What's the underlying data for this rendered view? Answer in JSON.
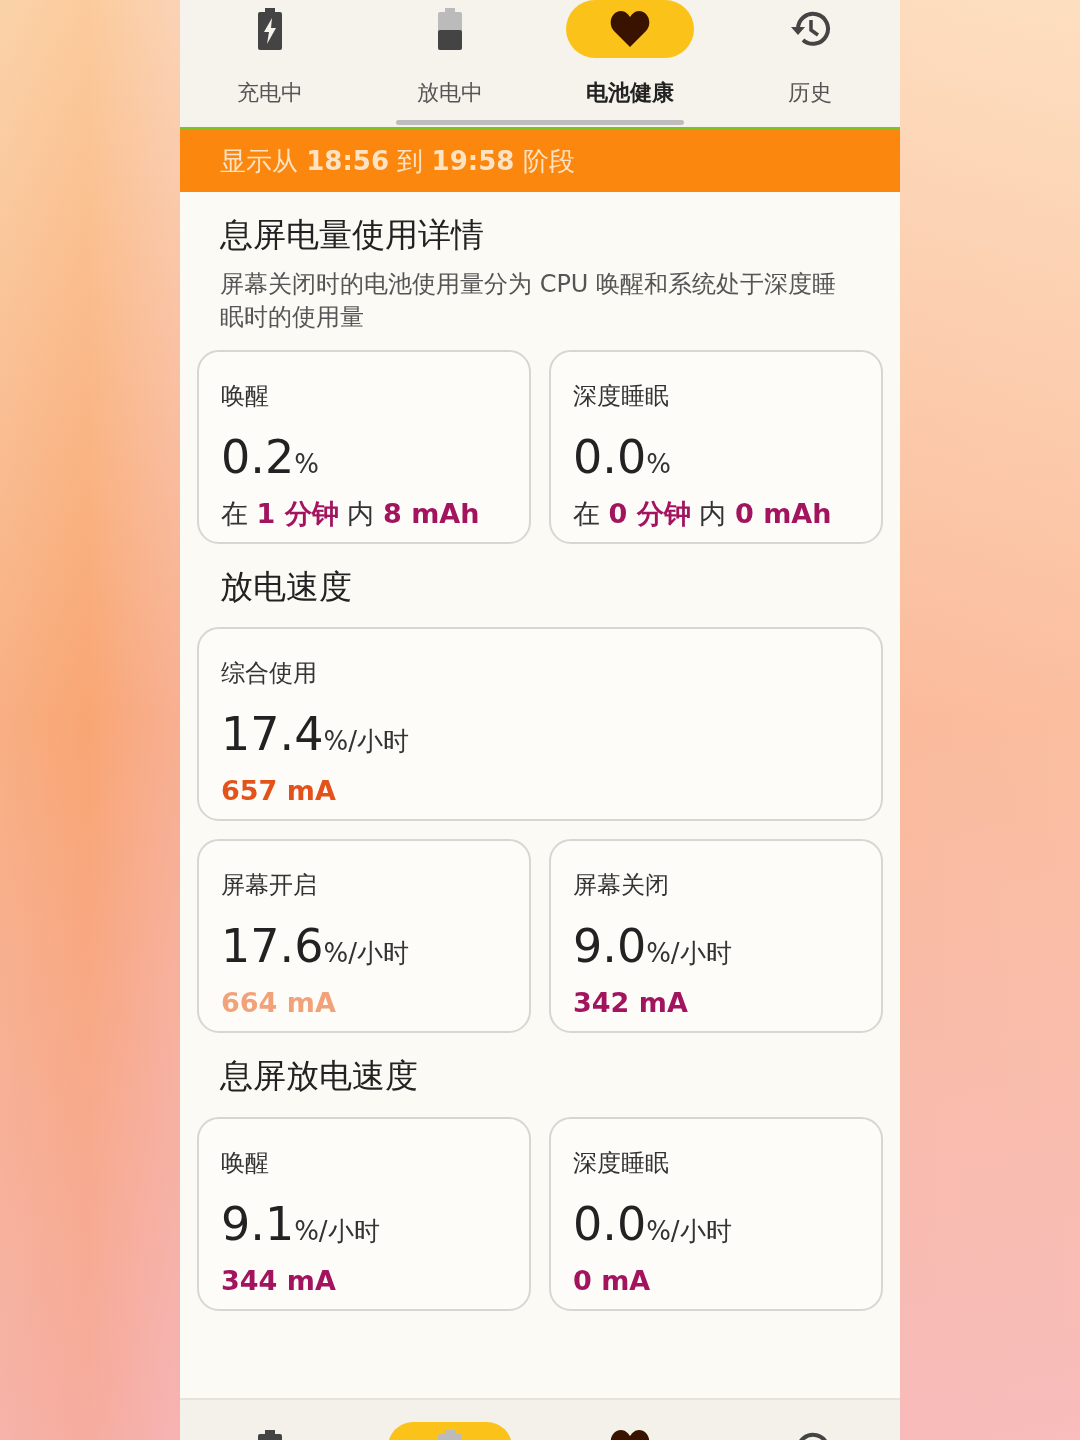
{
  "tabs": [
    {
      "label": "充电中",
      "selected": false
    },
    {
      "label": "放电中",
      "selected": false
    },
    {
      "label": "电池健康",
      "selected": true
    },
    {
      "label": "历史",
      "selected": false
    }
  ],
  "banner": "显示从 **18:56** 到 **19:58** 阶段",
  "sections": [
    {
      "title": "息屏电量使用详情",
      "description": "屏幕关闭时的电池使用量分为 CPU 唤醒和系统处于深度睡眠时的使用量",
      "cards": [
        {
          "label": "唤醒",
          "value": "0.2",
          "unit": "%",
          "detail": "在 **1 分钟** 内 **8 mAh**",
          "color": "#a3145f"
        },
        {
          "label": "深度睡眠",
          "value": "0.0",
          "unit": "%",
          "detail": "在 **0 分钟** 内 **0 mAh**",
          "color": "#a3145f"
        }
      ]
    },
    {
      "title": "放电速度",
      "cards": [
        {
          "label": "综合使用",
          "value": "17.4",
          "unit": "%/小时",
          "detail": "657 mA",
          "color": "#e4521c",
          "wide": true
        },
        {
          "label": "屏幕开启",
          "value": "17.6",
          "unit": "%/小时",
          "detail": "664 mA",
          "color": "#f2a27a"
        },
        {
          "label": "屏幕关闭",
          "value": "9.0",
          "unit": "%/小时",
          "detail": "342 mA",
          "color": "#a3145f"
        }
      ]
    },
    {
      "title": "息屏放电速度",
      "cards": [
        {
          "label": "唤醒",
          "value": "9.1",
          "unit": "%/小时",
          "detail": "344 mA",
          "color": "#a3145f"
        },
        {
          "label": "深度睡眠",
          "value": "0.0",
          "unit": "%/小时",
          "detail": "0 mA",
          "color": "#a3145f"
        }
      ]
    }
  ],
  "bottom_nav": [
    {
      "selected": false
    },
    {
      "selected": true
    },
    {
      "selected": false
    },
    {
      "selected": false
    }
  ]
}
